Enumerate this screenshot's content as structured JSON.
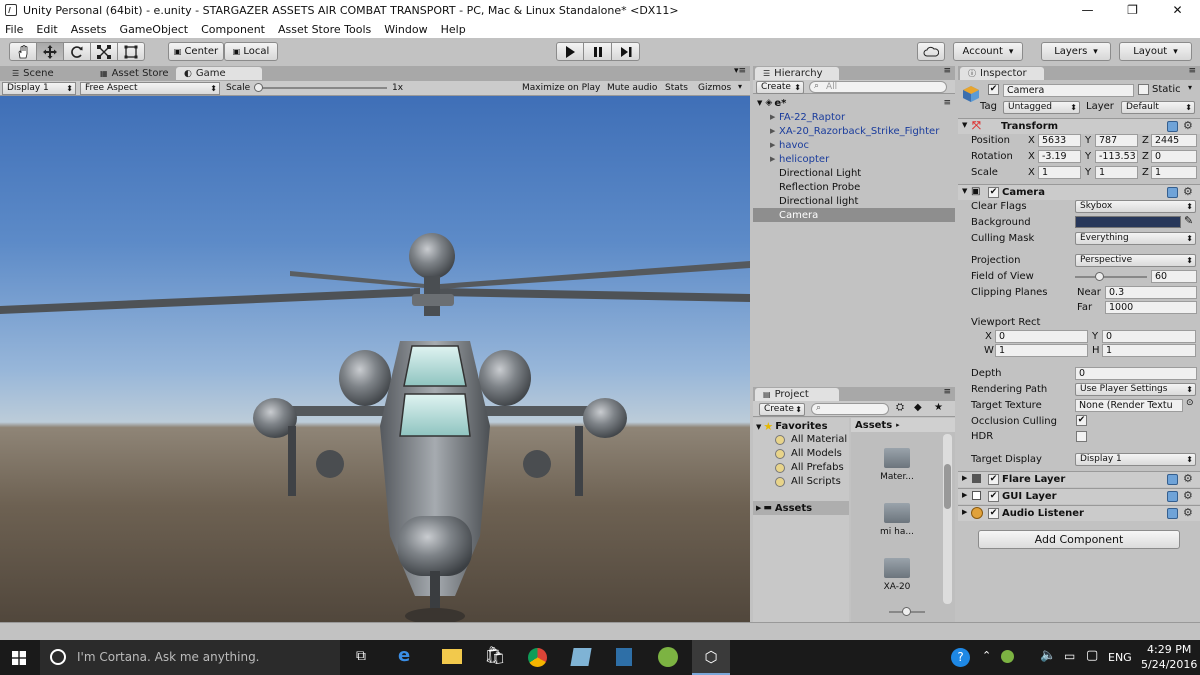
{
  "window": {
    "title": "Unity Personal (64bit) - e.unity - STARGAZER ASSETS  AIR COMBAT TRANSPORT - PC, Mac & Linux Standalone* <DX11>",
    "minimize": "—",
    "maximize": "❐",
    "close": "✕"
  },
  "menu": [
    "File",
    "Edit",
    "Assets",
    "GameObject",
    "Component",
    "Asset Store Tools",
    "Window",
    "Help"
  ],
  "toolbar": {
    "tools": [
      "hand-icon",
      "move-icon",
      "rotate-icon",
      "scale-icon",
      "rect-icon"
    ],
    "pivot": "Center",
    "space": "Local",
    "account": "Account",
    "layers": "Layers",
    "layout": "Layout"
  },
  "scene_tabs": {
    "scene": "Scene",
    "asset_store": "Asset Store",
    "game": "Game"
  },
  "game_bar": {
    "display": "Display 1",
    "aspect": "Free Aspect",
    "scale_label": "Scale",
    "scale_value": "1x",
    "maximize": "Maximize on Play",
    "mute": "Mute audio",
    "stats": "Stats",
    "gizmos": "Gizmos"
  },
  "hierarchy": {
    "tab": "Hierarchy",
    "create": "Create",
    "search_placeholder": "All",
    "scene": "e*",
    "items": [
      {
        "label": "FA-22_Raptor",
        "prefab": true,
        "arrow": true
      },
      {
        "label": "XA-20_Razorback_Strike_Fighter",
        "prefab": true,
        "arrow": true
      },
      {
        "label": "havoc",
        "prefab": true,
        "arrow": true
      },
      {
        "label": "helicopter",
        "prefab": true,
        "arrow": true
      },
      {
        "label": "Directional Light",
        "prefab": false,
        "arrow": false
      },
      {
        "label": "Reflection Probe",
        "prefab": false,
        "arrow": false
      },
      {
        "label": "Directional light",
        "prefab": false,
        "arrow": false
      },
      {
        "label": "Camera",
        "prefab": false,
        "arrow": false,
        "selected": true
      }
    ]
  },
  "project": {
    "tab": "Project",
    "create": "Create",
    "favorites": "Favorites",
    "fav_items": [
      "All Material",
      "All Models",
      "All Prefabs",
      "All Scripts"
    ],
    "assets_tree": "Assets",
    "breadcrumb": "Assets",
    "folders": [
      "Mater...",
      "mi ha...",
      "XA-20"
    ]
  },
  "inspector": {
    "tab": "Inspector",
    "object_name": "Camera",
    "static_label": "Static",
    "tag_label": "Tag",
    "tag_value": "Untagged",
    "layer_label": "Layer",
    "layer_value": "Default",
    "transform": {
      "title": "Transform",
      "position_label": "Position",
      "position": {
        "x": "5633",
        "y": "787",
        "z": "2445"
      },
      "rotation_label": "Rotation",
      "rotation": {
        "x": "-3.19",
        "y": "-113.53",
        "z": "0"
      },
      "scale_label": "Scale",
      "scale": {
        "x": "1",
        "y": "1",
        "z": "1"
      }
    },
    "camera": {
      "title": "Camera",
      "clear_flags_label": "Clear Flags",
      "clear_flags": "Skybox",
      "background_label": "Background",
      "background_color": "#27375a",
      "culling_label": "Culling Mask",
      "culling": "Everything",
      "projection_label": "Projection",
      "projection": "Perspective",
      "fov_label": "Field of View",
      "fov": "60",
      "fov_fraction": 0.33,
      "clipping_label": "Clipping Planes",
      "near_label": "Near",
      "near": "0.3",
      "far_label": "Far",
      "far": "1000",
      "viewport_label": "Viewport Rect",
      "vp_x_label": "X",
      "vp_x": "0",
      "vp_y_label": "Y",
      "vp_y": "0",
      "vp_w_label": "W",
      "vp_w": "1",
      "vp_h_label": "H",
      "vp_h": "1",
      "depth_label": "Depth",
      "depth": "0",
      "rendering_label": "Rendering Path",
      "rendering": "Use Player Settings",
      "target_tex_label": "Target Texture",
      "target_tex": "None (Render Textu",
      "occlusion_label": "Occlusion Culling",
      "occlusion_checked": true,
      "hdr_label": "HDR",
      "hdr_checked": false,
      "target_display_label": "Target Display",
      "target_display": "Display 1"
    },
    "components": [
      "Flare Layer",
      "GUI Layer",
      "Audio Listener"
    ],
    "add_component": "Add Component"
  },
  "taskbar": {
    "search": "I'm Cortana. Ask me anything.",
    "lang": "ENG",
    "time": "4:29 PM",
    "date": "5/24/2016"
  }
}
